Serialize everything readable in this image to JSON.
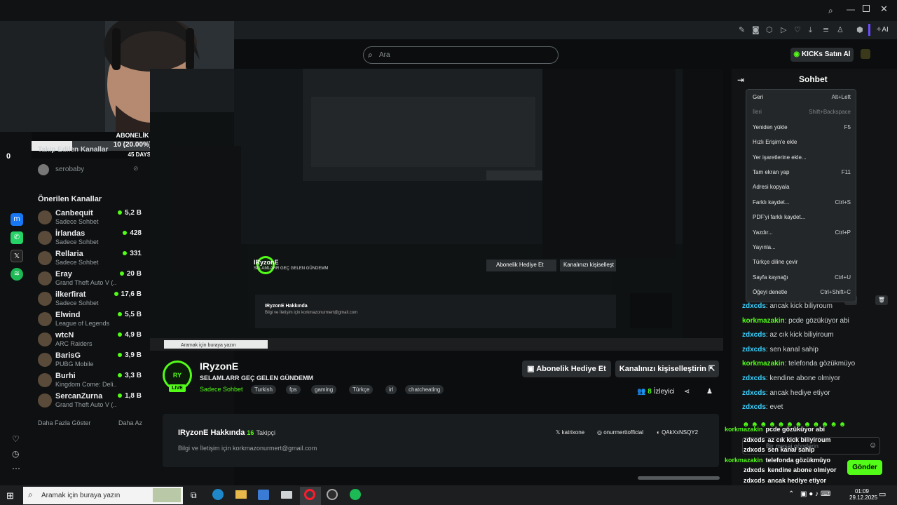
{
  "kick_logo": "K",
  "kick_count": "8",
  "overlay": {
    "subs_label": "ABONELİK",
    "subs_progress": "10 (20.00%)",
    "goal": "45 DAYS TO GO",
    "left_count": "0",
    "progress_fraction": 0.2
  },
  "followed": {
    "title": "Takip Edilen Kanallar",
    "item": "serobaby"
  },
  "recommended": {
    "title": "Önerilen Kanallar",
    "items": [
      {
        "name": "Canbequit",
        "category": "Sadece Sohbet",
        "viewers": "5,2 B"
      },
      {
        "name": "İrlandas",
        "category": "Sadece Sohbet",
        "viewers": "428"
      },
      {
        "name": "Rellaria",
        "category": "Sadece Sohbet",
        "viewers": "331"
      },
      {
        "name": "Eray",
        "category": "Grand Theft Auto V (...",
        "viewers": "20 B"
      },
      {
        "name": "ilkerfirat",
        "category": "Sadece Sohbet",
        "viewers": "17,6 B"
      },
      {
        "name": "Elwind",
        "category": "League of Legends",
        "viewers": "5,5 B"
      },
      {
        "name": "wtcN",
        "category": "ARC Raiders",
        "viewers": "4,9 B"
      },
      {
        "name": "BarisG",
        "category": "PUBG Mobile",
        "viewers": "3,9 B"
      },
      {
        "name": "Burhi",
        "category": "Kingdom Come: Deli...",
        "viewers": "3,3 B"
      },
      {
        "name": "SercanZurna",
        "category": "Grand Theft Auto V (...",
        "viewers": "1,8 B"
      }
    ],
    "more": "Daha Fazla Göster",
    "less": "Daha Az"
  },
  "search": {
    "placeholder": "Ara"
  },
  "kicks_button": "KICKs Satın Al",
  "toolbar_ai": "AI",
  "stream": {
    "channel": "IRyzonE",
    "title": "SELAMLARR GEÇ GELEN GÜNDEMM",
    "category": "Sadece Sohbet",
    "tags": [
      "Turkish",
      "fps",
      "gaming",
      "Türkçe",
      "irl",
      "chatcheating"
    ],
    "gift_button": "Abonelik Hediye Et",
    "customize_button": "Kanalınızı kişiselleştirin",
    "viewers_num": "8",
    "viewers_label": "İzleyici",
    "live_badge": "LIVE",
    "about_title": "IRyzonE Hakkında",
    "followers_num": "16",
    "followers_label": "Takipçi",
    "about_body": "Bilgi ve İletişim için korkmazonurmert@gmail.com",
    "social": [
      "katrixone",
      "onurmerttofficial",
      "QAkXxNSQY2"
    ]
  },
  "chat": {
    "title": "Sohbet",
    "messages": [
      {
        "user": "zdxcds",
        "text": "ancak kick biliyroum",
        "color": "b"
      },
      {
        "user": "korkmazakin",
        "text": "pcde gözüküyor abi",
        "color": "g"
      },
      {
        "user": "zdxcds",
        "text": "az cık kick biliyiroum",
        "color": "b"
      },
      {
        "user": "zdxcds",
        "text": "sen kanal sahip",
        "color": "b"
      },
      {
        "user": "korkmazakin",
        "text": "telefonda gözükmüyo",
        "color": "g"
      },
      {
        "user": "zdxcds",
        "text": "kendine abone olmiyor",
        "color": "b"
      },
      {
        "user": "zdxcds",
        "text": "ancak hediye etiyor",
        "color": "b"
      },
      {
        "user": "zdxcds",
        "text": "evet",
        "color": "b"
      }
    ],
    "overlay_lines": [
      {
        "user": "korkmazakin",
        "text": "pcde gözüküyor abi"
      },
      {
        "user": "zdxcds",
        "text": "az cık kick biliyiroum"
      },
      {
        "user": "zdxcds",
        "text": "sen kanal sahip"
      },
      {
        "user": "korkmazakin",
        "text": "telefonda gözükmüyo"
      },
      {
        "user": "zdxcds",
        "text": "kendine abone olmiyor"
      },
      {
        "user": "zdxcds",
        "text": "ancak hediye etiyor"
      },
      {
        "user": "zdxcds",
        "text": "evet"
      }
    ],
    "input_placeholder": "Bir mesaj gönderin",
    "send_button": "Gönder"
  },
  "context_menu": [
    {
      "label": "Geri",
      "key": "Alt+Left",
      "disabled": false
    },
    {
      "label": "İleri",
      "key": "Shift+Backspace",
      "disabled": true
    },
    {
      "label": "Yeniden yükle",
      "key": "F5",
      "disabled": false
    },
    {
      "label": "Hızlı Erişim'e ekle",
      "key": "",
      "disabled": false
    },
    {
      "label": "Yer işaretlerine ekle...",
      "key": "",
      "disabled": false
    },
    {
      "label": "Tam ekran yap",
      "key": "F11",
      "disabled": false
    },
    {
      "label": "Adresi kopyala",
      "key": "",
      "disabled": false
    },
    {
      "label": "Farklı kaydet...",
      "key": "Ctrl+S",
      "disabled": false
    },
    {
      "label": "PDF'yi farklı kaydet...",
      "key": "",
      "disabled": false
    },
    {
      "label": "Yazdır...",
      "key": "Ctrl+P",
      "disabled": false
    },
    {
      "label": "Yayınla...",
      "key": "",
      "disabled": false
    },
    {
      "label": "Türkçe diline çevir",
      "key": "",
      "disabled": false
    },
    {
      "label": "Sayfa kaynağı",
      "key": "Ctrl+U",
      "disabled": false
    },
    {
      "label": "Öğeyi denetle",
      "key": "Ctrl+Shift+C",
      "disabled": false
    }
  ],
  "taskbar": {
    "search": "Aramak için buraya yazın",
    "time": "01:09",
    "date": "29.12.2025"
  },
  "colors": {
    "kick_green": "#53fc18",
    "chat_blue": "#3ad2ff"
  }
}
